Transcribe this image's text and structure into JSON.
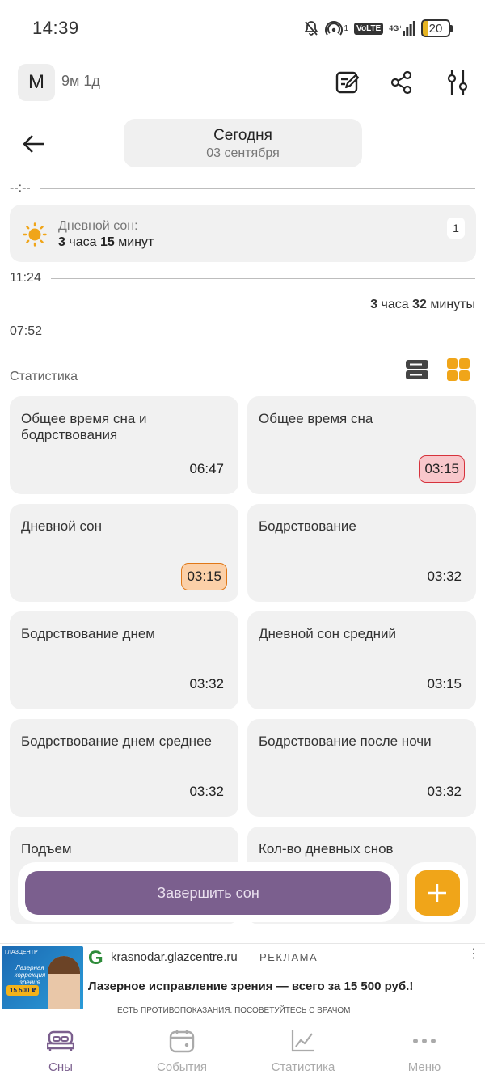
{
  "status_bar": {
    "time": "14:39",
    "hotspot_count": "1",
    "volte": "VoLTE",
    "network": "4G⁺",
    "battery": "20",
    "icons": [
      "bell-off-icon",
      "hotspot-icon",
      "volte-icon",
      "signal-icon",
      "battery-icon"
    ]
  },
  "header": {
    "avatar_letter": "M",
    "age": "9м 1д",
    "actions": [
      "edit-notes-icon",
      "share-icon",
      "sliders-icon"
    ]
  },
  "date_nav": {
    "title": "Сегодня",
    "subtitle": "03 сентября"
  },
  "timeline": {
    "top_marker": "--:--",
    "sleep": {
      "title": "Дневной сон:",
      "hours": "3",
      "hours_unit": "часа",
      "minutes": "15",
      "minutes_unit": "минут",
      "count": "1"
    },
    "end_time": "11:24",
    "awake": {
      "hours": "3",
      "hours_unit": "часа",
      "minutes": "32",
      "minutes_unit": "минуты"
    },
    "start_time": "07:52"
  },
  "stats": {
    "title": "Статистика",
    "cards": [
      {
        "label": "Общее время сна и бодрствования",
        "value": "06:47",
        "highlight": "none"
      },
      {
        "label": "Общее время сна",
        "value": "03:15",
        "highlight": "red"
      },
      {
        "label": "Дневной сон",
        "value": "03:15",
        "highlight": "orange"
      },
      {
        "label": "Бодрствование",
        "value": "03:32",
        "highlight": "none"
      },
      {
        "label": "Бодрствование днем",
        "value": "03:32",
        "highlight": "none"
      },
      {
        "label": "Дневной сон средний",
        "value": "03:15",
        "highlight": "none"
      },
      {
        "label": "Бодрствование днем среднее",
        "value": "03:32",
        "highlight": "none"
      },
      {
        "label": "Бодрствование после ночи",
        "value": "03:32",
        "highlight": "none"
      },
      {
        "label": "Подъем",
        "value": "",
        "highlight": "none"
      },
      {
        "label": "Кол-во дневных снов",
        "value": "",
        "highlight": "none"
      }
    ]
  },
  "actions": {
    "finish_sleep": "Завершить сон",
    "add": "+"
  },
  "ad": {
    "image_brand": "ГЛАЗЦЕНТР",
    "image_text": "Лазерная коррекция зрения",
    "image_price": "15 500 ₽",
    "logo": "G",
    "domain": "krasnodar.glazcentre.ru",
    "tag": "РЕКЛАМА",
    "headline": "Лазерное исправление зрения — всего за 15 500 руб.!",
    "note": "ЕСТЬ ПРОТИВОПОКАЗАНИЯ. ПОСОВЕТУЙТЕСЬ С ВРАЧОМ"
  },
  "bottom_nav": {
    "items": [
      {
        "label": "Сны",
        "icon": "bed-icon"
      },
      {
        "label": "События",
        "icon": "calendar-icon"
      },
      {
        "label": "Статистика",
        "icon": "chart-icon"
      },
      {
        "label": "Меню",
        "icon": "more-icon"
      }
    ]
  },
  "colors": {
    "accent_purple": "#7b5f8e",
    "accent_orange": "#f0a519",
    "highlight_red": "#f8c7cb",
    "highlight_orange": "#fbd0a8",
    "card_bg": "#f1f1f1"
  }
}
